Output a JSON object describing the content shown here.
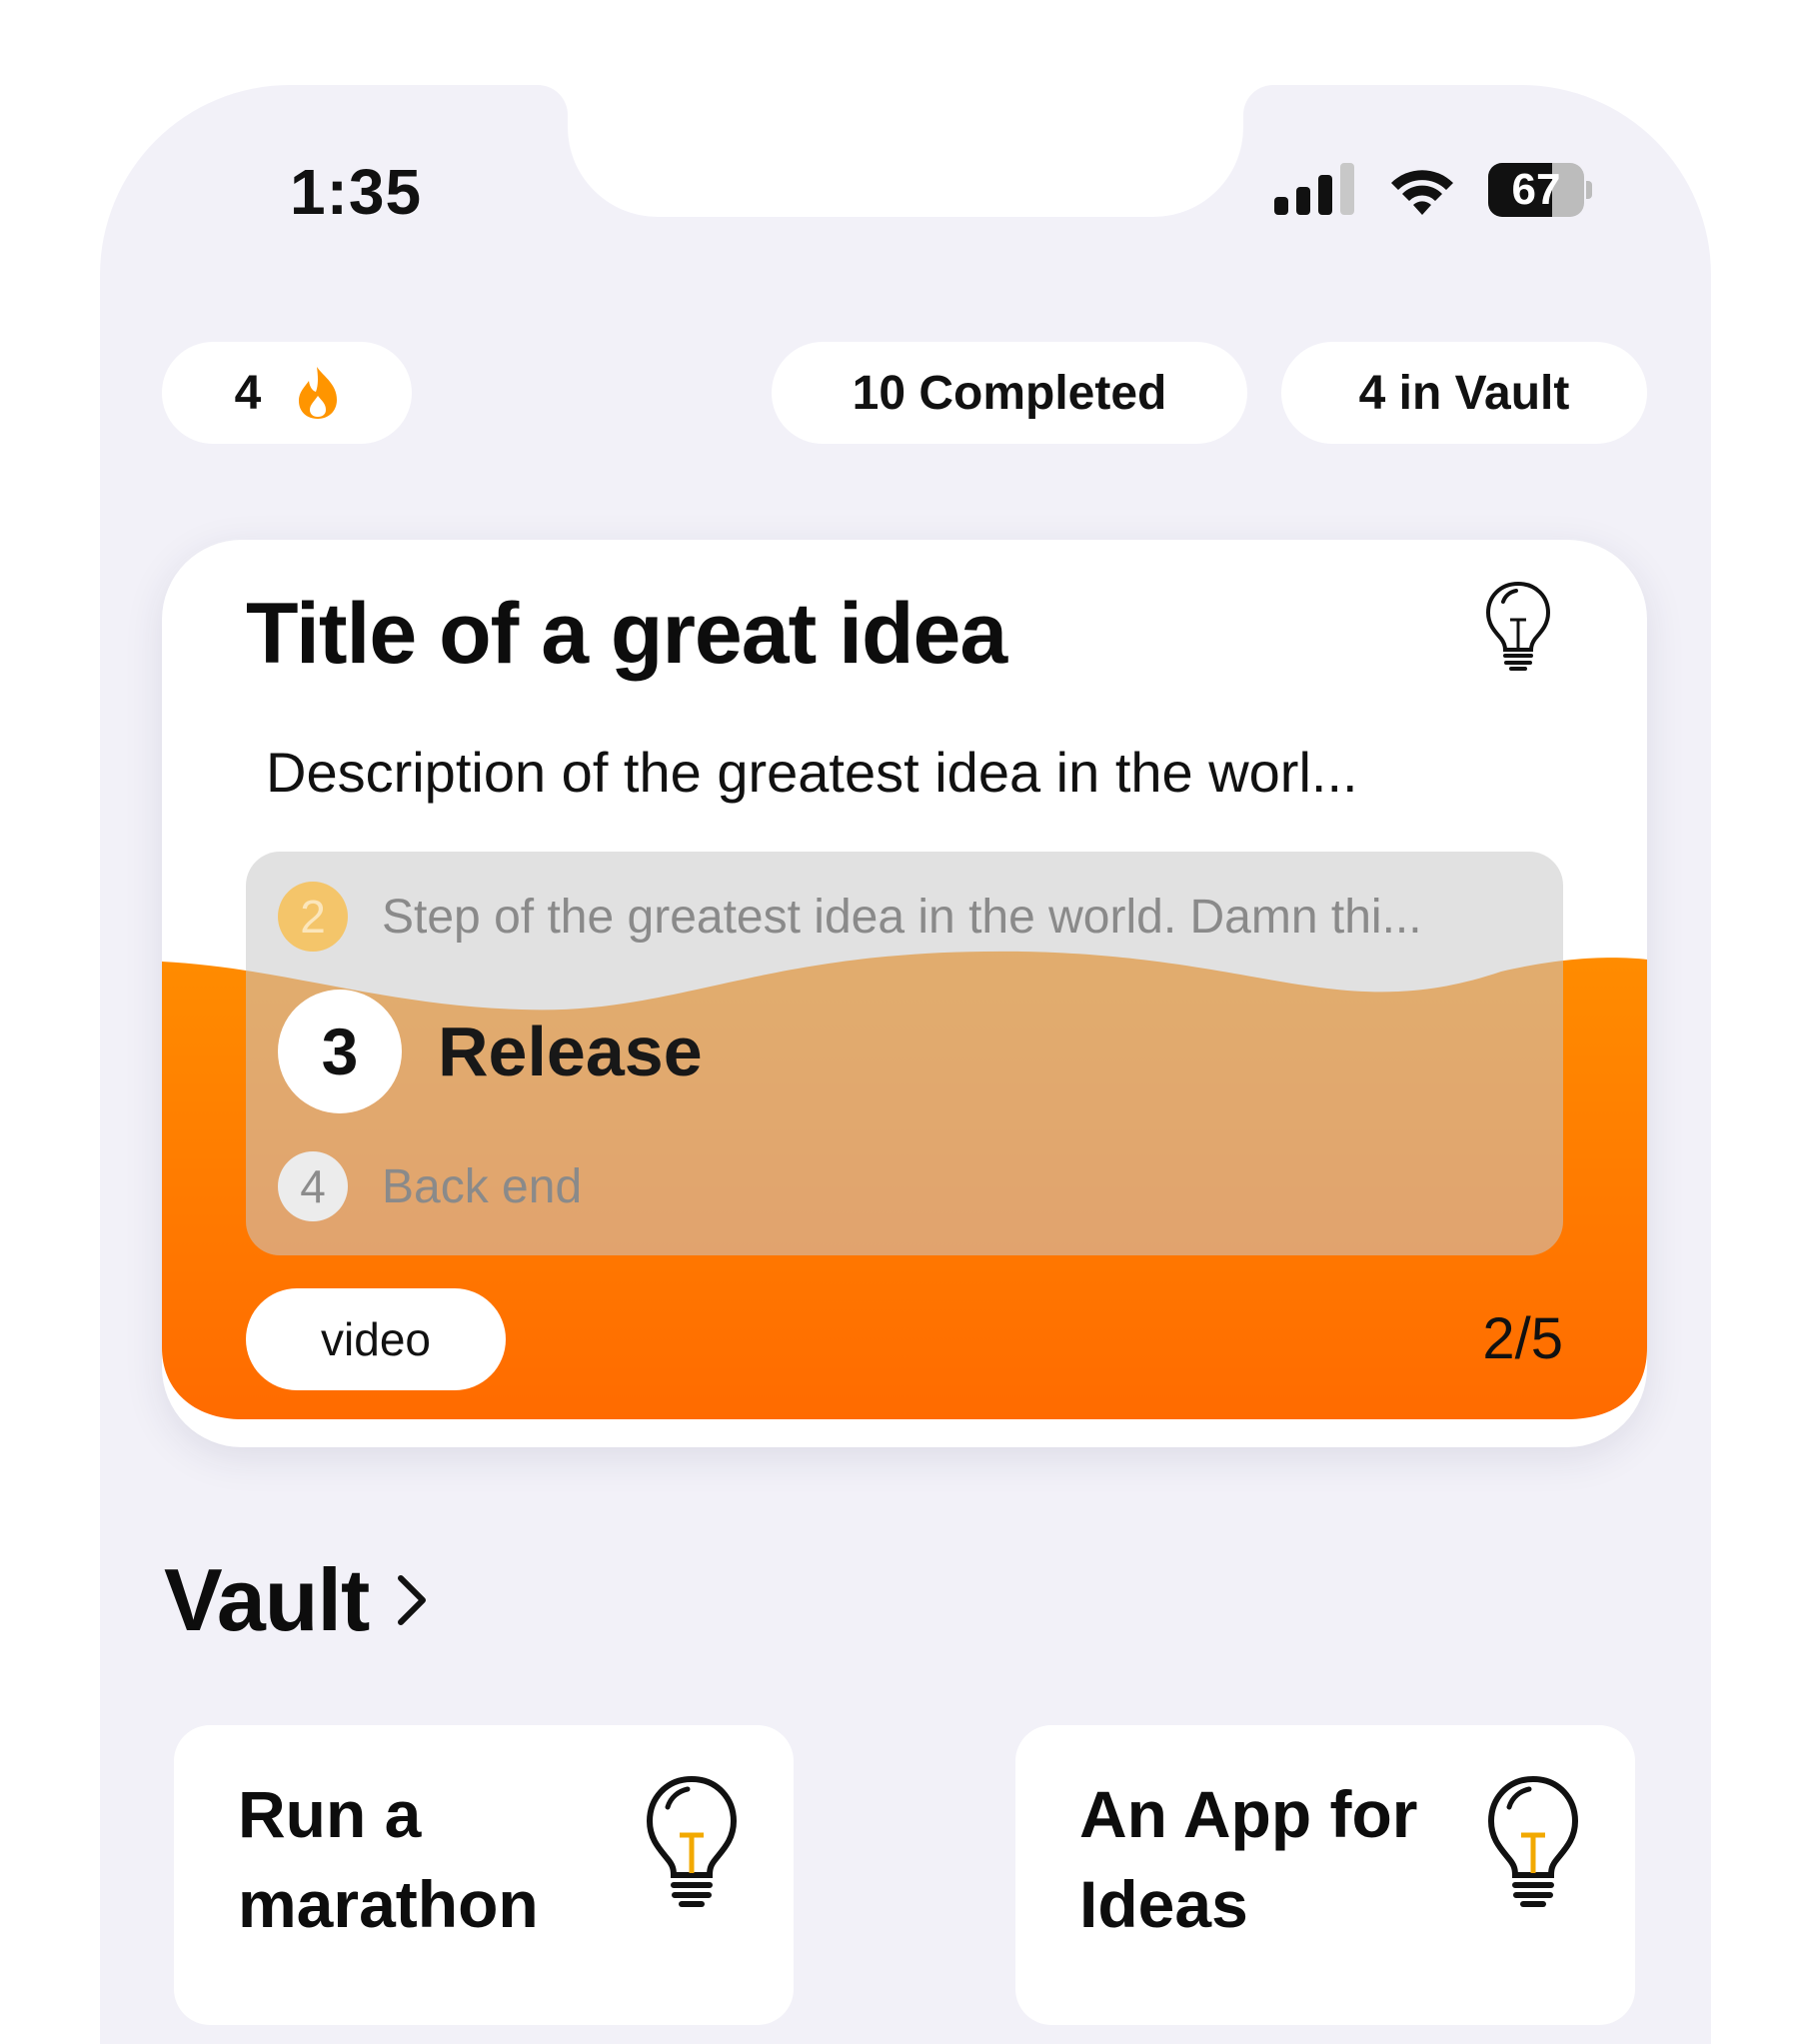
{
  "status_bar": {
    "time": "1:35",
    "battery_level": 67,
    "battery_text": "67",
    "icons": [
      "cellular-signal-icon",
      "wifi-icon",
      "battery-icon"
    ]
  },
  "stats": {
    "streak_count": "4",
    "streak_icon": "flame-icon",
    "completed_label": "10 Completed",
    "vault_label": "4 in Vault"
  },
  "featured": {
    "title": "Title of a great idea",
    "icon": "lightbulb-icon",
    "description": "Description of the greatest idea in the worl...",
    "steps": {
      "previous": {
        "number": "2",
        "text": "Step of the greatest idea in the world. Damn thi..."
      },
      "current": {
        "number": "3",
        "text": "Release"
      },
      "next": {
        "number": "4",
        "text": "Back end"
      }
    },
    "tag": "video",
    "progress": "2/5",
    "colors": {
      "accent_top": "#ff8a00",
      "accent_bottom": "#ff6a00"
    }
  },
  "vault": {
    "title": "Vault",
    "items": [
      {
        "title": "Run a marathon",
        "icon": "lightbulb-icon"
      },
      {
        "title": "An App for Ideas",
        "icon": "lightbulb-icon"
      }
    ]
  }
}
